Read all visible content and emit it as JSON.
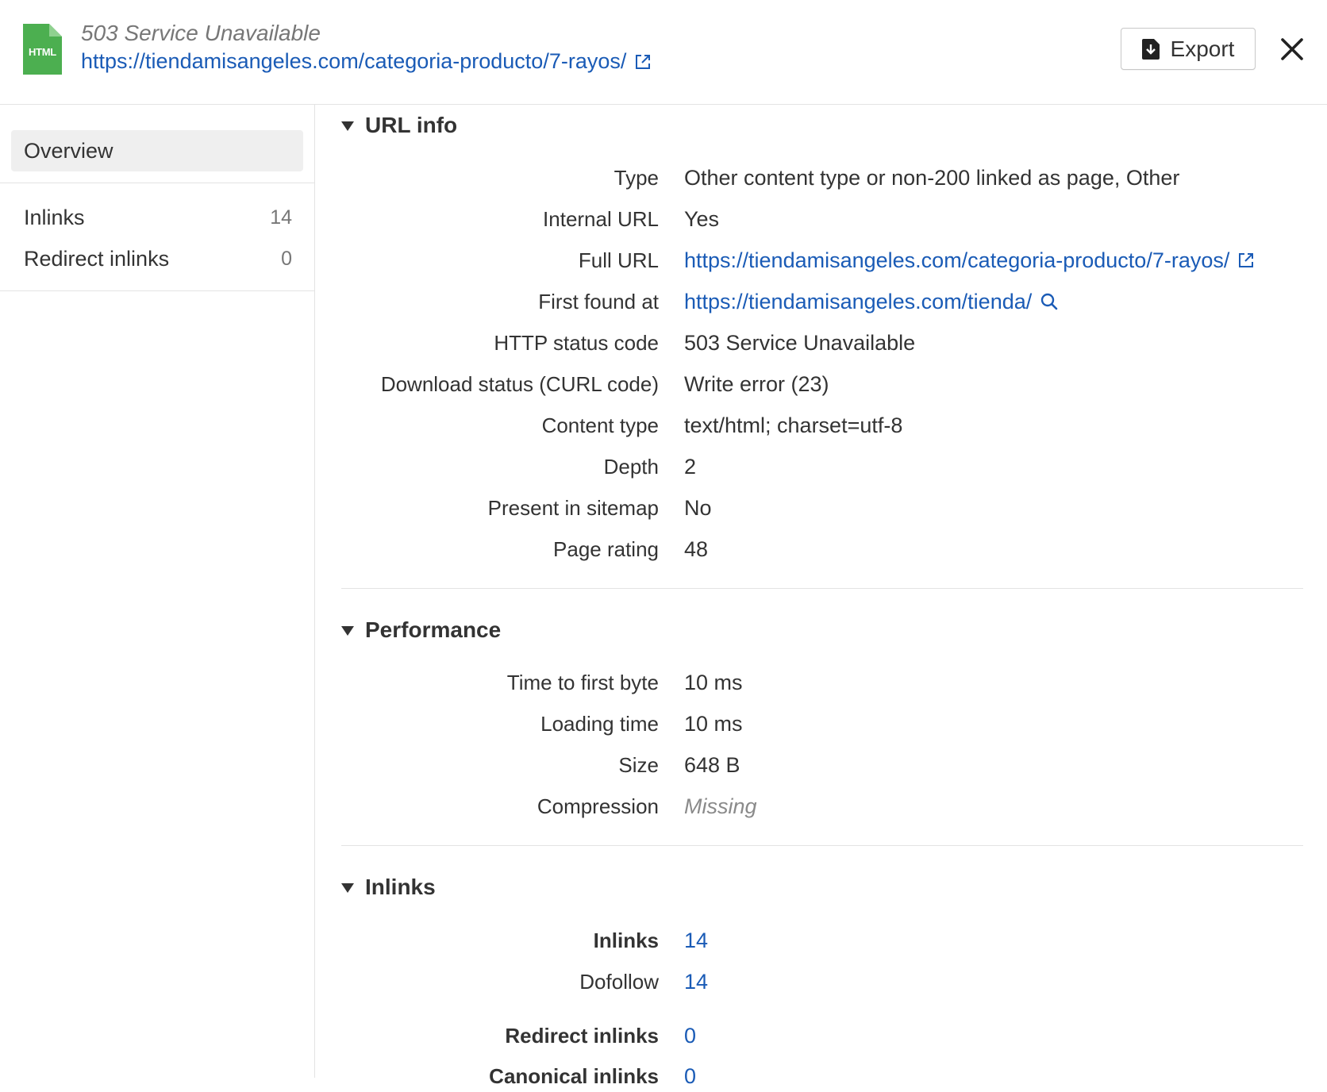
{
  "header": {
    "file_type": "HTML",
    "subtitle": "503 Service Unavailable",
    "url": "https://tiendamisangeles.com/categoria-producto/7-rayos/",
    "export_label": "Export"
  },
  "colors": {
    "file_icon": "#4caf50",
    "file_icon_fold": "#8fd18f",
    "link": "#1a5bb6",
    "muted": "#8a8a8a"
  },
  "sidebar": {
    "overview_label": "Overview",
    "items": [
      {
        "label": "Inlinks",
        "count": "14"
      },
      {
        "label": "Redirect inlinks",
        "count": "0"
      }
    ]
  },
  "sections": {
    "url_info": {
      "title": "URL info",
      "rows": [
        {
          "label": "Type",
          "value": "Other content type or non-200 linked as page, Other"
        },
        {
          "label": "Internal URL",
          "value": "Yes"
        },
        {
          "label": "Full URL",
          "value": "https://tiendamisangeles.com/categoria-producto/7-rayos/"
        },
        {
          "label": "First found at",
          "value": "https://tiendamisangeles.com/tienda/"
        },
        {
          "label": "HTTP status code",
          "value": "503 Service Unavailable"
        },
        {
          "label": "Download status (CURL code)",
          "value": "Write error (23)"
        },
        {
          "label": "Content type",
          "value": "text/html; charset=utf-8"
        },
        {
          "label": "Depth",
          "value": "2"
        },
        {
          "label": "Present in sitemap",
          "value": "No"
        },
        {
          "label": "Page rating",
          "value": "48"
        }
      ]
    },
    "performance": {
      "title": "Performance",
      "rows": [
        {
          "label": "Time to first byte",
          "value": "10 ms"
        },
        {
          "label": "Loading time",
          "value": "10 ms"
        },
        {
          "label": "Size",
          "value": "648 B"
        },
        {
          "label": "Compression",
          "value": "Missing"
        }
      ]
    },
    "inlinks": {
      "title": "Inlinks",
      "rows": [
        {
          "label": "Inlinks",
          "value": "14"
        },
        {
          "label": "Dofollow",
          "value": "14"
        },
        {
          "label": "Redirect inlinks",
          "value": "0"
        },
        {
          "label": "Canonical inlinks",
          "value": "0"
        }
      ]
    }
  }
}
